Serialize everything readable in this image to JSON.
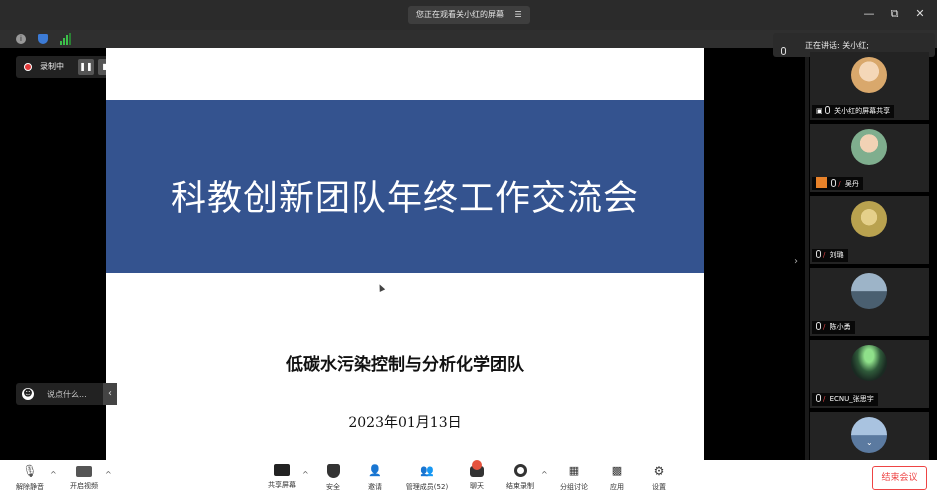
{
  "window": {
    "screen_share_notice": "您正在观看关小红的屏幕",
    "menu_icon": "☰",
    "controls": [
      "—",
      "⧉",
      "✕"
    ]
  },
  "recording": {
    "label": "录制中"
  },
  "slide": {
    "title": "科教创新团队年终工作交流会",
    "subtitle": "低碳水污染控制与分析化学团队",
    "date": "2023年01月13日"
  },
  "chat": {
    "placeholder": "说点什么..."
  },
  "speaker": {
    "label": "正在讲话: 关小红;"
  },
  "participants": [
    {
      "name": "关小红的屏幕共享",
      "avatar_color": "#d9a86c"
    },
    {
      "name": "吴丹",
      "avatar_color": "#7fae8e"
    },
    {
      "name": "刘璐",
      "avatar_color": "#b9a24f"
    },
    {
      "name": "陈小勇",
      "avatar_color": "#6f8aa3"
    },
    {
      "name": "ECNU_张思宇",
      "avatar_color": "#3f6d4b"
    },
    {
      "name": "",
      "avatar_color": "#7b9bc2"
    }
  ],
  "toolbar": {
    "mute": "解除静音",
    "video": "开启视频",
    "share": "共享屏幕",
    "security": "安全",
    "invite": "邀请",
    "members": "管理成员(52)",
    "chat": "聊天",
    "record": "结束录制",
    "breakout": "分组讨论",
    "apps": "应用",
    "settings": "设置",
    "end": "结束会议"
  },
  "colors": {
    "slide_band": "#34538f",
    "end_red": "#e44444",
    "rec_red": "#e23a3a"
  }
}
